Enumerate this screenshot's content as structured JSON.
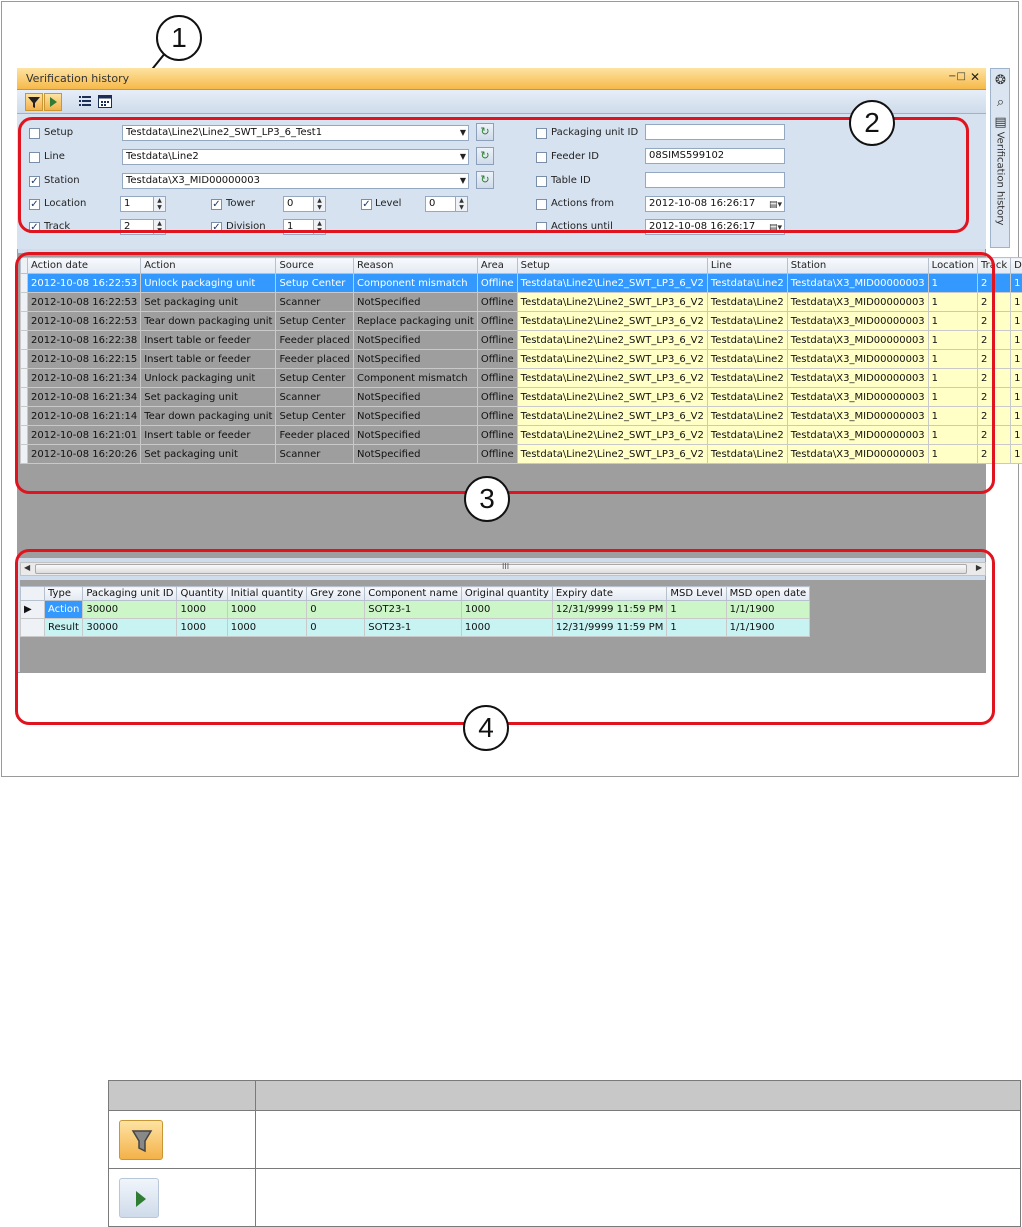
{
  "window": {
    "title": "Verification  history",
    "sidebar_label": "Verification history"
  },
  "callouts": [
    "1",
    "2",
    "3",
    "4"
  ],
  "filters": {
    "setup": {
      "label": "Setup",
      "checked": false,
      "value": "Testdata\\Line2\\Line2_SWT_LP3_6_Test1"
    },
    "line": {
      "label": "Line",
      "checked": false,
      "value": "Testdata\\Line2"
    },
    "station": {
      "label": "Station",
      "checked": true,
      "value": "Testdata\\X3_MID00000003"
    },
    "location": {
      "label": "Location",
      "checked": true,
      "value": "1"
    },
    "track": {
      "label": "Track",
      "checked": true,
      "value": "2"
    },
    "tower": {
      "label": "Tower",
      "checked": true,
      "value": "0"
    },
    "division": {
      "label": "Division",
      "checked": true,
      "value": "1"
    },
    "level": {
      "label": "Level",
      "checked": true,
      "value": "0"
    },
    "packaging_unit_id": {
      "label": "Packaging unit ID",
      "checked": false,
      "value": ""
    },
    "feeder_id": {
      "label": "Feeder ID",
      "checked": false,
      "value": "08SIMS599102"
    },
    "table_id": {
      "label": "Table ID",
      "checked": false,
      "value": ""
    },
    "actions_from": {
      "label": "Actions from",
      "checked": false,
      "value": "2012-10-08 16:26:17"
    },
    "actions_until": {
      "label": "Actions until",
      "checked": false,
      "value": "2012-10-08 16:26:17"
    }
  },
  "history": {
    "columns": [
      "Action date",
      "Action",
      "Source",
      "Reason",
      "Area",
      "Setup",
      "Line",
      "Station",
      "Location",
      "Track",
      "Divi"
    ],
    "rows": [
      [
        "2012-10-08 16:22:53",
        "Unlock packaging unit",
        "Setup Center",
        "Component mismatch",
        "Offline",
        "Testdata\\Line2\\Line2_SWT_LP3_6_V2",
        "Testdata\\Line2",
        "Testdata\\X3_MID00000003",
        "1",
        "2",
        "1"
      ],
      [
        "2012-10-08 16:22:53",
        "Set packaging unit",
        "Scanner",
        "NotSpecified",
        "Offline",
        "Testdata\\Line2\\Line2_SWT_LP3_6_V2",
        "Testdata\\Line2",
        "Testdata\\X3_MID00000003",
        "1",
        "2",
        "1"
      ],
      [
        "2012-10-08 16:22:53",
        "Tear down packaging unit",
        "Setup Center",
        "Replace packaging unit",
        "Offline",
        "Testdata\\Line2\\Line2_SWT_LP3_6_V2",
        "Testdata\\Line2",
        "Testdata\\X3_MID00000003",
        "1",
        "2",
        "1"
      ],
      [
        "2012-10-08 16:22:38",
        "Insert table or feeder",
        "Feeder placed",
        "NotSpecified",
        "Offline",
        "Testdata\\Line2\\Line2_SWT_LP3_6_V2",
        "Testdata\\Line2",
        "Testdata\\X3_MID00000003",
        "1",
        "2",
        "1"
      ],
      [
        "2012-10-08 16:22:15",
        "Insert table or feeder",
        "Feeder placed",
        "NotSpecified",
        "Offline",
        "Testdata\\Line2\\Line2_SWT_LP3_6_V2",
        "Testdata\\Line2",
        "Testdata\\X3_MID00000003",
        "1",
        "2",
        "1"
      ],
      [
        "2012-10-08 16:21:34",
        "Unlock packaging unit",
        "Setup Center",
        "Component mismatch",
        "Offline",
        "Testdata\\Line2\\Line2_SWT_LP3_6_V2",
        "Testdata\\Line2",
        "Testdata\\X3_MID00000003",
        "1",
        "2",
        "1"
      ],
      [
        "2012-10-08 16:21:34",
        "Set packaging unit",
        "Scanner",
        "NotSpecified",
        "Offline",
        "Testdata\\Line2\\Line2_SWT_LP3_6_V2",
        "Testdata\\Line2",
        "Testdata\\X3_MID00000003",
        "1",
        "2",
        "1"
      ],
      [
        "2012-10-08 16:21:14",
        "Tear down packaging unit",
        "Setup Center",
        "NotSpecified",
        "Offline",
        "Testdata\\Line2\\Line2_SWT_LP3_6_V2",
        "Testdata\\Line2",
        "Testdata\\X3_MID00000003",
        "1",
        "2",
        "1"
      ],
      [
        "2012-10-08 16:21:01",
        "Insert table or feeder",
        "Feeder placed",
        "NotSpecified",
        "Offline",
        "Testdata\\Line2\\Line2_SWT_LP3_6_V2",
        "Testdata\\Line2",
        "Testdata\\X3_MID00000003",
        "1",
        "2",
        "1"
      ],
      [
        "2012-10-08 16:20:26",
        "Set packaging unit",
        "Scanner",
        "NotSpecified",
        "Offline",
        "Testdata\\Line2\\Line2_SWT_LP3_6_V2",
        "Testdata\\Line2",
        "Testdata\\X3_MID00000003",
        "1",
        "2",
        "1"
      ]
    ]
  },
  "detail": {
    "columns": [
      "Type",
      "Packaging unit ID",
      "Quantity",
      "Initial quantity",
      "Grey zone",
      "Component name",
      "Original quantity",
      "Expiry date",
      "MSD Level",
      "MSD open date"
    ],
    "rows": [
      [
        "Action",
        "30000",
        "1000",
        "1000",
        "0",
        "SOT23-1",
        "1000",
        "12/31/9999 11:59 PM",
        "1",
        "1/1/1900"
      ],
      [
        "Result",
        "30000",
        "1000",
        "1000",
        "0",
        "SOT23-1",
        "1000",
        "12/31/9999 11:59 PM",
        "1",
        "1/1/1900"
      ]
    ]
  },
  "scrollbar": {
    "grip": "III"
  },
  "colors": {
    "accent_orange": "#f6b94a",
    "highlight_red": "#e0141e",
    "selection_blue": "#3399ff",
    "setup_yellow": "#ffffc6",
    "action_green": "#ccf5c8",
    "result_cyan": "#c8f3f3"
  }
}
